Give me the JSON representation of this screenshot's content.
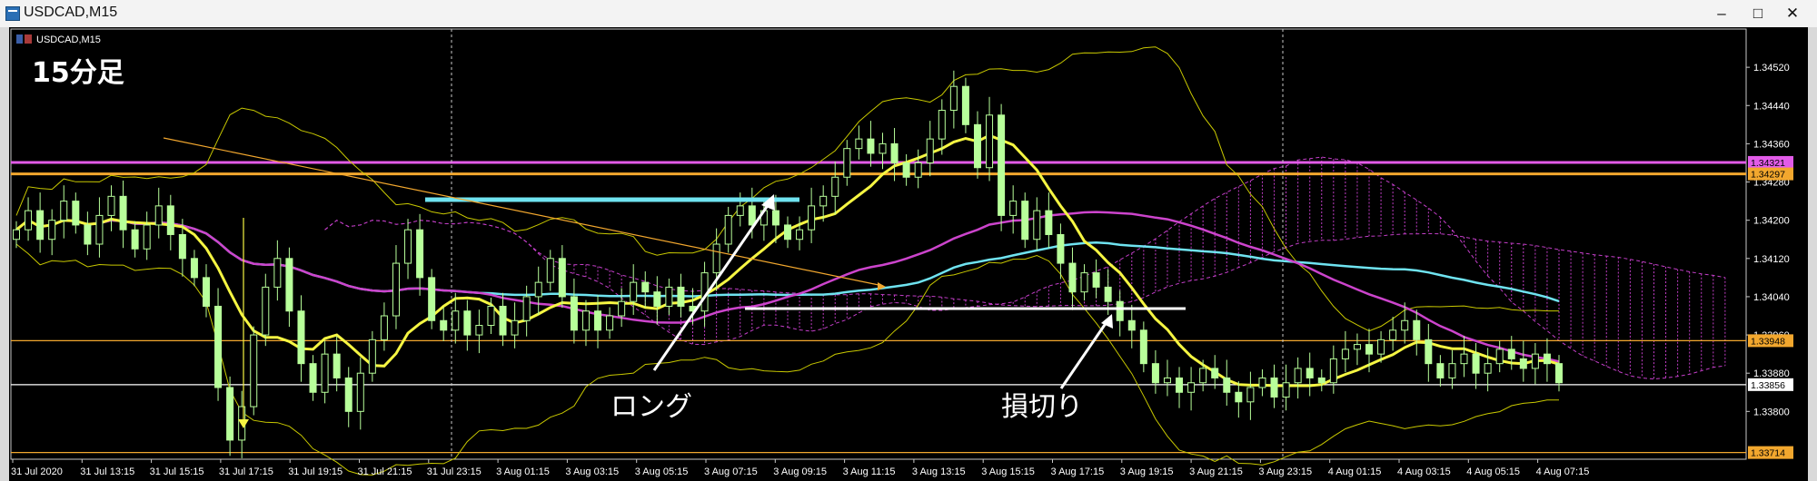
{
  "window": {
    "title": "USDCAD,M15",
    "minimize_label": "–",
    "maximize_label": "□",
    "close_label": "✕"
  },
  "chart_header": {
    "symbol_label": "USDCAD,M15",
    "caption": "15分足"
  },
  "annotations": {
    "long_label": "ロング",
    "stop_label": "損切り"
  },
  "colors": {
    "background": "#000000",
    "candle": "#b8ff9a",
    "price_line_magenta": "#e25be8",
    "price_line_orange": "#f2a72e",
    "ma_yellow": "#f5f542",
    "ma_cyan": "#6fe3f0",
    "ma_magenta": "#cc44cc",
    "band": "#c8c800",
    "cloud": "#c23ec7"
  },
  "icons": [
    "window-icon",
    "chart-icons"
  ],
  "chart_data": {
    "type": "candlestick",
    "symbol": "USDCAD",
    "timeframe": "M15",
    "ylim": [
      1.337,
      1.346
    ],
    "y_ticks": [
      "1.34520",
      "1.34440",
      "1.34360",
      "1.34280",
      "1.34200",
      "1.34120",
      "1.34040",
      "1.33960",
      "1.33880",
      "1.33800"
    ],
    "x_ticks": [
      "31 Jul 2020",
      "31 Jul 13:15",
      "31 Jul 15:15",
      "31 Jul 17:15",
      "31 Jul 19:15",
      "31 Jul 21:15",
      "31 Jul 23:15",
      "3 Aug 01:15",
      "3 Aug 03:15",
      "3 Aug 05:15",
      "3 Aug 07:15",
      "3 Aug 09:15",
      "3 Aug 11:15",
      "3 Aug 13:15",
      "3 Aug 15:15",
      "3 Aug 17:15",
      "3 Aug 19:15",
      "3 Aug 21:15",
      "3 Aug 23:15",
      "4 Aug 01:15",
      "4 Aug 03:15",
      "4 Aug 05:15",
      "4 Aug 07:15"
    ],
    "price_labels": [
      {
        "value": 1.34321,
        "text": "1.34321",
        "color": "#e25be8"
      },
      {
        "value": 1.34297,
        "text": "1.34297",
        "color": "#f2a72e"
      },
      {
        "value": 1.33948,
        "text": "1.33948",
        "color": "#f2a72e"
      },
      {
        "value": 1.33856,
        "text": "1.33856",
        "color": "#ffffff"
      },
      {
        "value": 1.33714,
        "text": "1.33714",
        "color": "#f2a72e"
      }
    ],
    "horizontal_lines": [
      {
        "value": 1.34321,
        "color": "#e25be8"
      },
      {
        "value": 1.34297,
        "color": "#f2a72e"
      },
      {
        "value": 1.33948,
        "color": "#f2a72e"
      },
      {
        "value": 1.33856,
        "color": "#ffffff"
      },
      {
        "value": 1.33714,
        "color": "#f2a72e"
      }
    ],
    "closes": [
      1.3418,
      1.3422,
      1.3416,
      1.342,
      1.3424,
      1.3419,
      1.3415,
      1.3421,
      1.3425,
      1.3418,
      1.3414,
      1.3419,
      1.3423,
      1.3417,
      1.3412,
      1.3408,
      1.3402,
      1.3385,
      1.3374,
      1.3381,
      1.3396,
      1.3406,
      1.3412,
      1.3401,
      1.339,
      1.3384,
      1.3392,
      1.3387,
      1.338,
      1.3388,
      1.3395,
      1.34,
      1.3411,
      1.3418,
      1.3408,
      1.3399,
      1.3397,
      1.3401,
      1.3396,
      1.3398,
      1.3402,
      1.3396,
      1.3399,
      1.3404,
      1.3407,
      1.3412,
      1.3404,
      1.3397,
      1.3401,
      1.3397,
      1.34,
      1.3403,
      1.3407,
      1.3405,
      1.3402,
      1.3406,
      1.3402,
      1.3401,
      1.3409,
      1.3415,
      1.3421,
      1.3423,
      1.3419,
      1.3422,
      1.3419,
      1.3416,
      1.3418,
      1.3423,
      1.3425,
      1.3429,
      1.3435,
      1.3437,
      1.3434,
      1.3436,
      1.3432,
      1.3429,
      1.3432,
      1.3437,
      1.3443,
      1.3448,
      1.344,
      1.3431,
      1.3442,
      1.3421,
      1.3424,
      1.3416,
      1.3422,
      1.3417,
      1.3411,
      1.3405,
      1.3409,
      1.3406,
      1.3403,
      1.3399,
      1.3397,
      1.339,
      1.3386,
      1.3387,
      1.3384,
      1.3386,
      1.3389,
      1.3387,
      1.3384,
      1.3382,
      1.3385,
      1.3387,
      1.3383,
      1.3386,
      1.3389,
      1.3387,
      1.3386,
      1.3391,
      1.3393,
      1.3394,
      1.3392,
      1.3395,
      1.3397,
      1.3399,
      1.3395,
      1.339,
      1.3387,
      1.339,
      1.3392,
      1.3388,
      1.339,
      1.3393,
      1.3391,
      1.3389,
      1.3392,
      1.339,
      1.3386
    ]
  }
}
